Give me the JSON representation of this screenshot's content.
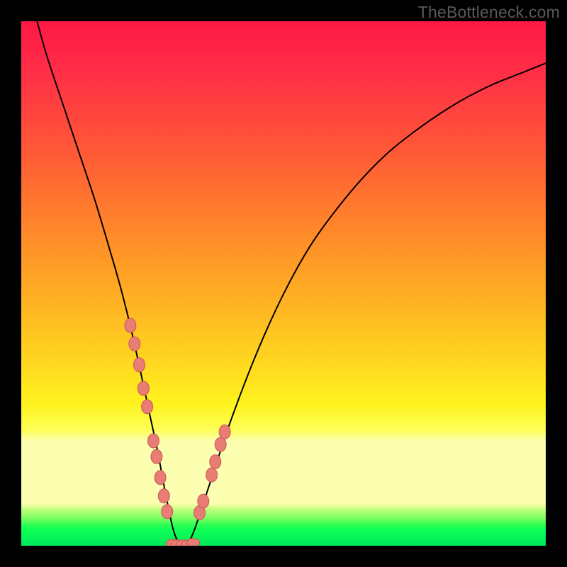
{
  "watermark": "TheBottleneck.com",
  "colors": {
    "background_black": "#000000",
    "marker_fill": "#e97c75",
    "marker_stroke": "#c45a54",
    "curve": "#000000",
    "gradient_stops": [
      "#ff1846",
      "#ff5936",
      "#ffa724",
      "#fff31e",
      "#fdffb0",
      "#2fff55",
      "#00e85a"
    ]
  },
  "chart_data": {
    "type": "line",
    "title": "",
    "xlabel": "",
    "ylabel": "",
    "xlim": [
      0,
      100
    ],
    "ylim": [
      0,
      100
    ],
    "legend": null,
    "grid": false,
    "series": [
      {
        "name": "bottleneck-curve",
        "x": [
          3,
          5,
          8,
          11,
          14,
          17,
          19,
          21,
          23,
          24.5,
          26,
          27.5,
          29,
          30.3,
          31.5,
          33,
          36,
          40,
          45,
          50,
          55,
          60,
          65,
          70,
          75,
          80,
          85,
          90,
          95,
          100
        ],
        "y": [
          100,
          93,
          84,
          75,
          66,
          56,
          49,
          41,
          32,
          25,
          18,
          10,
          3,
          0.2,
          0.2,
          3,
          12,
          24,
          37,
          48,
          57,
          64,
          70,
          75,
          79,
          82.5,
          85.5,
          88,
          90,
          92
        ]
      }
    ],
    "markers_left": {
      "name": "left-cluster",
      "x": [
        20.8,
        21.6,
        22.5,
        23.3,
        24.0,
        25.2,
        25.8,
        26.5,
        27.2,
        27.8
      ],
      "y": [
        42,
        38.5,
        34.5,
        30,
        26.5,
        20,
        17,
        13,
        9.5,
        6.5
      ]
    },
    "markers_right": {
      "name": "right-cluster",
      "x": [
        34.0,
        34.7,
        36.3,
        37.0,
        38.0,
        38.8
      ],
      "y": [
        6.3,
        8.5,
        13.5,
        16,
        19.3,
        21.7
      ]
    },
    "markers_bottom": {
      "name": "bottom-cluster",
      "x": [
        28.8,
        29.7,
        30.8,
        31.8,
        32.8
      ],
      "y": [
        0.4,
        0.3,
        0.3,
        0.3,
        0.6
      ]
    }
  }
}
